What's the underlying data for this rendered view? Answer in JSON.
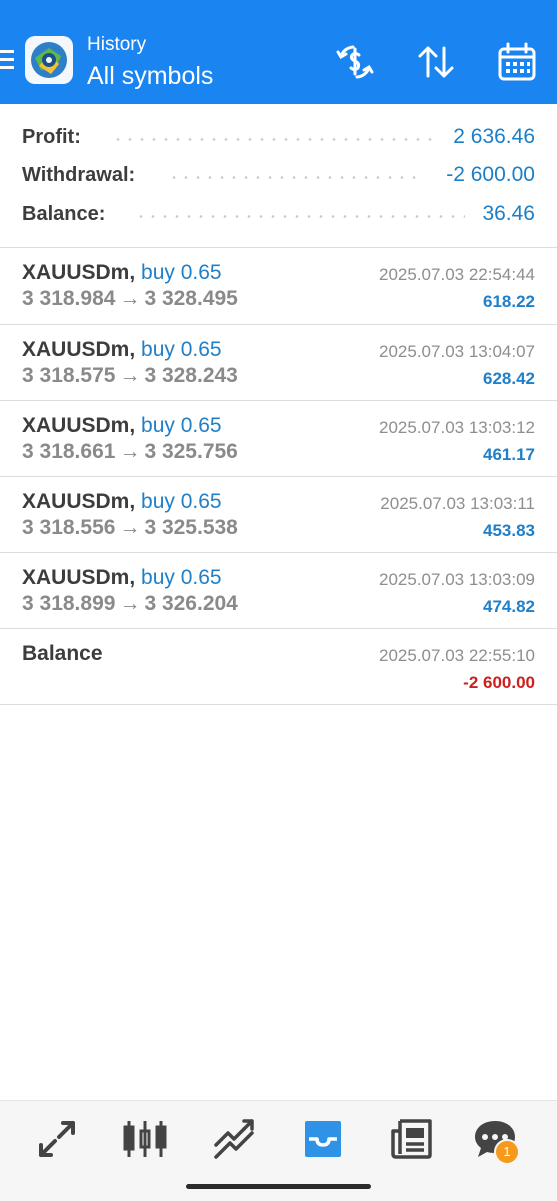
{
  "header": {
    "title": "History",
    "subtitle": "All symbols",
    "accent": "#1a85f1"
  },
  "summary": {
    "profit_label": "Profit:",
    "profit_value": "2 636.46",
    "withdrawal_label": "Withdrawal:",
    "withdrawal_value": "-2 600.00",
    "balance_label": "Balance:",
    "balance_value": "36.46"
  },
  "deals": [
    {
      "symbol": "XAUUSDm,",
      "type": "buy 0.65",
      "open_price": "3 318.984",
      "arrow": "→",
      "close_price": "3 328.495",
      "time": "2025.07.03 22:54:44",
      "profit": "618.22"
    },
    {
      "symbol": "XAUUSDm,",
      "type": "buy 0.65",
      "open_price": "3 318.575",
      "arrow": "→",
      "close_price": "3 328.243",
      "time": "2025.07.03 13:04:07",
      "profit": "628.42"
    },
    {
      "symbol": "XAUUSDm,",
      "type": "buy 0.65",
      "open_price": "3 318.661",
      "arrow": "→",
      "close_price": "3 325.756",
      "time": "2025.07.03 13:03:12",
      "profit": "461.17"
    },
    {
      "symbol": "XAUUSDm,",
      "type": "buy 0.65",
      "open_price": "3 318.556",
      "arrow": "→",
      "close_price": "3 325.538",
      "time": "2025.07.03 13:03:11",
      "profit": "453.83"
    },
    {
      "symbol": "XAUUSDm,",
      "type": "buy 0.65",
      "open_price": "3 318.899",
      "arrow": "→",
      "close_price": "3 326.204",
      "time": "2025.07.03 13:03:09",
      "profit": "474.82"
    }
  ],
  "balance_op": {
    "label": "Balance",
    "time": "2025.07.03 22:55:10",
    "amount": "-2 600.00"
  },
  "icons": {
    "header_actions": [
      "dollar-exchange-icon",
      "sort-icon",
      "calendar-icon"
    ],
    "bottom_nav": [
      "quotes-icon",
      "chart-icon",
      "trade-icon",
      "history-icon",
      "news-icon",
      "chat-icon"
    ]
  },
  "bottom_nav": {
    "active": "history",
    "active_color": "#2e93e6",
    "inactive_color": "#444444",
    "chat_badge": "1"
  }
}
